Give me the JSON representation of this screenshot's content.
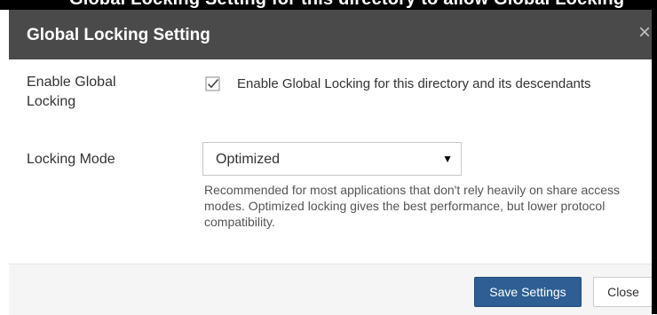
{
  "background_title_fragment": "Global Locking Setting for this directory to allow Global Locking",
  "dialog": {
    "title": "Global Locking Setting",
    "close_glyph": "×"
  },
  "global_locking": {
    "label": "Enable Global Locking",
    "checked": true,
    "checkbox_text": "Enable Global Locking for this directory and its descendants"
  },
  "locking_mode": {
    "label": "Locking Mode",
    "selected": "Optimized",
    "help": "Recommended for most applications that don't rely heavily on share access modes. Optimized locking gives the best performance, but lower protocol compatibility."
  },
  "footer": {
    "save_label": "Save Settings",
    "close_label": "Close"
  },
  "colors": {
    "header_bg": "#4a4a4a",
    "primary_button": "#2e5e93"
  }
}
